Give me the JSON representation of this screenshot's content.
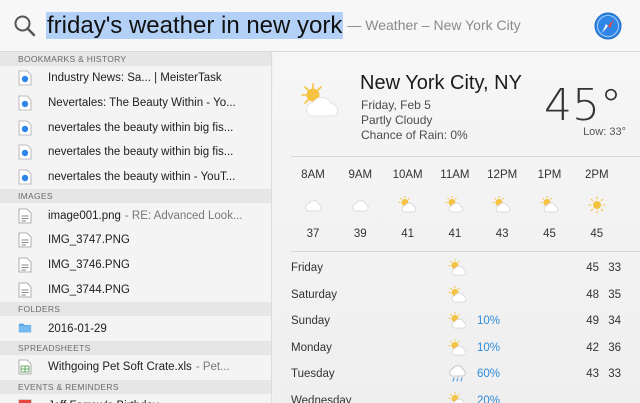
{
  "search": {
    "query": "friday's weather in new york",
    "suffix": "— Weather – New York City"
  },
  "icons": {
    "search": "magnifier-icon",
    "safari": "safari-compass-icon"
  },
  "sections": [
    {
      "title": "BOOKMARKS & HISTORY",
      "icon": "web-document-icon",
      "items": [
        {
          "text": "Industry News: Sa... | MeisterTask",
          "sub": ""
        },
        {
          "text": "Nevertales: The Beauty Within - Yo...",
          "sub": ""
        },
        {
          "text": "nevertales the beauty within big fis...",
          "sub": ""
        },
        {
          "text": "nevertales the beauty within big fis...",
          "sub": ""
        },
        {
          "text": "nevertales the beauty within - YouT...",
          "sub": ""
        }
      ]
    },
    {
      "title": "IMAGES",
      "icon": "image-file-icon",
      "items": [
        {
          "text": "image001.png",
          "sub": "- RE: Advanced Look..."
        },
        {
          "text": "IMG_3747.PNG",
          "sub": ""
        },
        {
          "text": "IMG_3746.PNG",
          "sub": ""
        },
        {
          "text": "IMG_3744.PNG",
          "sub": ""
        }
      ]
    },
    {
      "title": "FOLDERS",
      "icon": "folder-icon",
      "items": [
        {
          "text": "2016-01-29",
          "sub": ""
        }
      ]
    },
    {
      "title": "SPREADSHEETS",
      "icon": "spreadsheet-file-icon",
      "items": [
        {
          "text": "Withgoing Pet Soft Crate.xls",
          "sub": "- Pet..."
        }
      ]
    },
    {
      "title": "EVENTS & REMINDERS",
      "icon": "calendar-icon",
      "items": [
        {
          "text": "Jeff Farrow's Birthday",
          "sub": ""
        }
      ]
    }
  ],
  "weather": {
    "city": "New York City, NY",
    "date": "Friday, Feb 5",
    "condition": "Partly Cloudy",
    "rain": "Chance of Rain: 0%",
    "temp": "45°",
    "low": "Low: 33°",
    "hourly": [
      {
        "time": "8AM",
        "temp": "37",
        "icon": "cloud-icon"
      },
      {
        "time": "9AM",
        "temp": "39",
        "icon": "cloud-icon"
      },
      {
        "time": "10AM",
        "temp": "41",
        "icon": "partly-cloudy-icon"
      },
      {
        "time": "11AM",
        "temp": "41",
        "icon": "partly-cloudy-icon"
      },
      {
        "time": "12PM",
        "temp": "43",
        "icon": "partly-cloudy-icon"
      },
      {
        "time": "1PM",
        "temp": "45",
        "icon": "partly-cloudy-icon"
      },
      {
        "time": "2PM",
        "temp": "45",
        "icon": "sun-icon"
      }
    ],
    "daily": [
      {
        "day": "Friday",
        "precip": "",
        "high": "45",
        "low": "33",
        "icon": "partly-cloudy-icon"
      },
      {
        "day": "Saturday",
        "precip": "",
        "high": "48",
        "low": "35",
        "icon": "partly-cloudy-icon"
      },
      {
        "day": "Sunday",
        "precip": "10%",
        "high": "49",
        "low": "34",
        "icon": "partly-cloudy-icon"
      },
      {
        "day": "Monday",
        "precip": "10%",
        "high": "42",
        "low": "36",
        "icon": "partly-cloudy-icon"
      },
      {
        "day": "Tuesday",
        "precip": "60%",
        "high": "43",
        "low": "33",
        "icon": "rain-icon"
      },
      {
        "day": "Wednesday",
        "precip": "20%",
        "high": "",
        "low": "",
        "icon": "partly-cloudy-icon"
      }
    ]
  },
  "colors": {
    "highlight": "#b3d1f7",
    "precip": "#2f8bd9",
    "sun": "#f5c242"
  }
}
